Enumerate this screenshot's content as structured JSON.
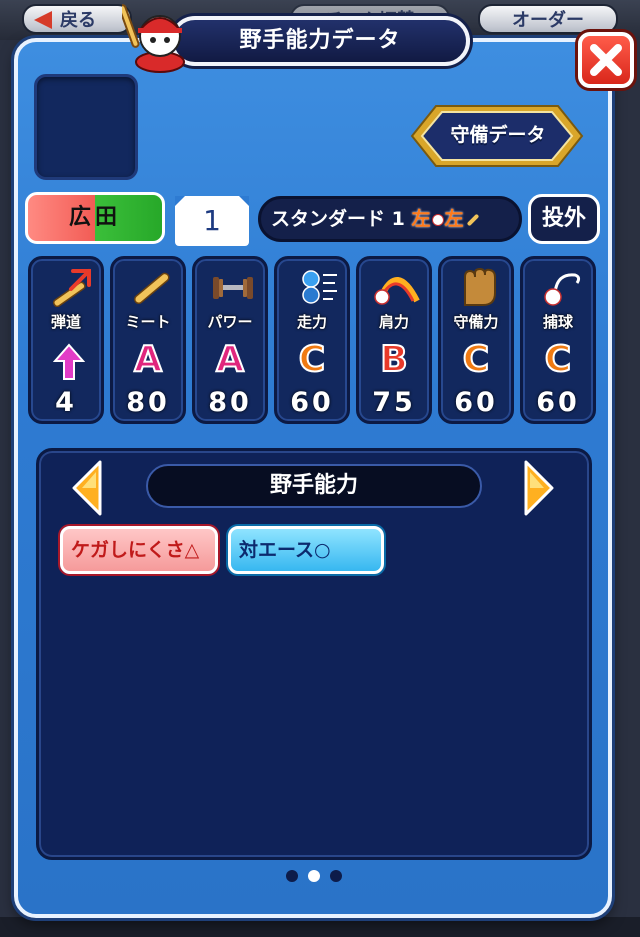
{
  "background": {
    "back_label": "戻る",
    "team_switch_label": "チーム切替",
    "order_label": "オーダー"
  },
  "modal": {
    "title": "野手能力データ",
    "defense_button_label": "守備データ",
    "player": {
      "team": "広田",
      "number": "1",
      "form_label": "スタンダード",
      "form_number": "1",
      "throws": "左",
      "bats": "左",
      "position": "投外"
    },
    "stats": [
      {
        "name": "弾道",
        "grade": "",
        "value": "4",
        "icon": "trajectory-bat-icon"
      },
      {
        "name": "ミート",
        "grade": "A",
        "value": "80",
        "icon": "bat-icon"
      },
      {
        "name": "パワー",
        "grade": "A",
        "value": "80",
        "icon": "dumbbell-icon"
      },
      {
        "name": "走力",
        "grade": "C",
        "value": "60",
        "icon": "running-ball-icon"
      },
      {
        "name": "肩力",
        "grade": "B",
        "value": "75",
        "icon": "throw-arc-icon"
      },
      {
        "name": "守備力",
        "grade": "C",
        "value": "60",
        "icon": "glove-icon"
      },
      {
        "name": "捕球",
        "grade": "C",
        "value": "60",
        "icon": "catch-ball-icon"
      }
    ],
    "panel": {
      "title": "野手能力",
      "skills": [
        "ケガしにくさ△",
        "対エース○"
      ]
    },
    "pagination": {
      "total": 3,
      "active": 2
    }
  },
  "colors": {
    "grade_A": "#e0267d",
    "grade_B": "#e83a2a",
    "grade_C": "#f07a12",
    "modal_blue": "#2e7bd2",
    "panel_navy": "#0f2258"
  }
}
